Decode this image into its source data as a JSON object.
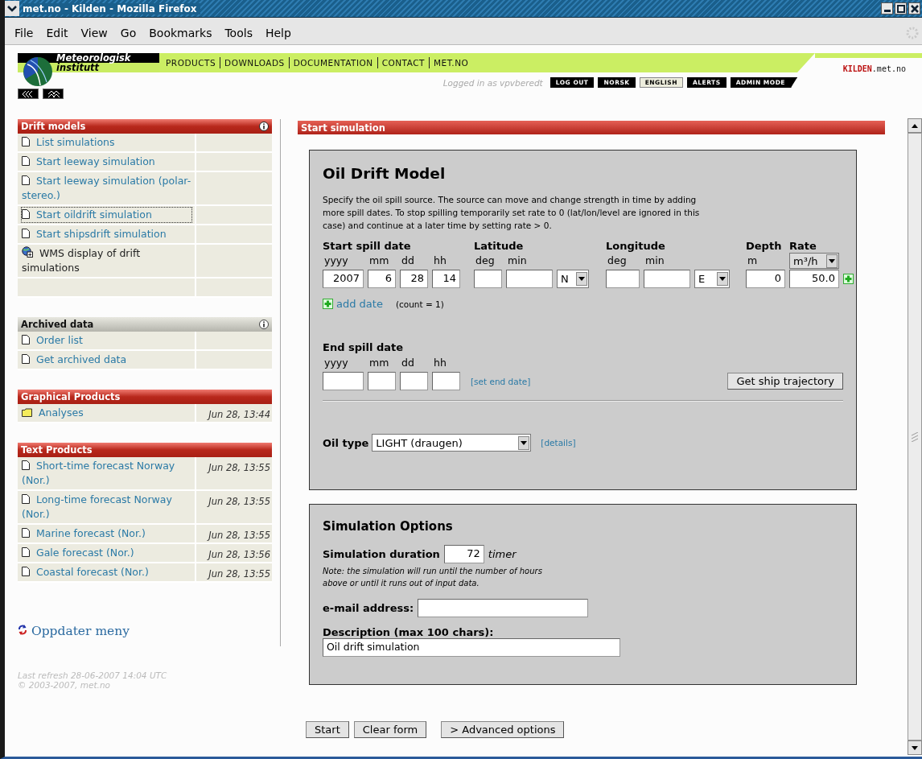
{
  "window": {
    "title": "met.no - Kilden - Mozilla Firefox"
  },
  "menu": [
    "File",
    "Edit",
    "View",
    "Go",
    "Bookmarks",
    "Tools",
    "Help"
  ],
  "header": {
    "logo_line1": "Meteorologisk",
    "logo_line2": "institutt",
    "nav": [
      "PRODUCTS",
      "DOWNLOADS",
      "DOCUMENTATION",
      "CONTACT",
      "MET.NO"
    ],
    "logged_in": "Logged in as vpvberedt",
    "buttons": [
      {
        "label": "LOG OUT",
        "selected": false
      },
      {
        "label": "NORSK",
        "selected": false
      },
      {
        "label": "ENGLISH",
        "selected": true
      },
      {
        "label": "ALERTS",
        "selected": false
      },
      {
        "label": "ADMIN MODE",
        "selected": false
      }
    ],
    "site": "KILDEN",
    "site_suffix": ".met.no"
  },
  "sidebar": [
    {
      "title": "Drift models",
      "kind": "primary",
      "info": true,
      "trailing_blank": true,
      "items": [
        {
          "label": "List simulations",
          "kind": "page",
          "link": true,
          "selected": false
        },
        {
          "label": "Start leeway simulation",
          "kind": "page",
          "link": true,
          "selected": false
        },
        {
          "label": "Start leeway simulation (polar-stereo.)",
          "kind": "page",
          "link": true,
          "selected": false
        },
        {
          "label": "Start oildrift simulation",
          "kind": "page",
          "link": true,
          "selected": true
        },
        {
          "label": "Start shipsdrift simulation",
          "kind": "page",
          "link": true,
          "selected": false
        },
        {
          "label": "WMS display of drift simulations",
          "kind": "globe",
          "link": false,
          "selected": false
        }
      ]
    },
    {
      "title": "Archived data",
      "kind": "secondary",
      "info": true,
      "trailing_blank": false,
      "items": [
        {
          "label": "Order list",
          "kind": "page",
          "link": true,
          "selected": false
        },
        {
          "label": "Get archived data",
          "kind": "page",
          "link": true,
          "selected": false
        }
      ]
    },
    {
      "title": "Graphical Products",
      "kind": "primary",
      "info": false,
      "trailing_blank": false,
      "items": [
        {
          "label": "Analyses",
          "kind": "folder",
          "link": true,
          "selected": false,
          "time": "Jun 28, 13:44"
        }
      ]
    },
    {
      "title": "Text Products",
      "kind": "primary",
      "info": false,
      "trailing_blank": false,
      "items": [
        {
          "label": "Short-time forecast Norway (Nor.)",
          "kind": "page",
          "link": true,
          "selected": false,
          "time": "Jun 28, 13:55"
        },
        {
          "label": "Long-time forecast Norway (Nor.)",
          "kind": "page",
          "link": true,
          "selected": false,
          "time": "Jun 28, 13:55"
        },
        {
          "label": "Marine forecast (Nor.)",
          "kind": "page",
          "link": true,
          "selected": false,
          "time": "Jun 28, 13:55"
        },
        {
          "label": "Gale forecast (Nor.)",
          "kind": "page",
          "link": true,
          "selected": false,
          "time": "Jun 28, 13:56"
        },
        {
          "label": "Coastal forecast (Nor.)",
          "kind": "page",
          "link": true,
          "selected": false,
          "time": "Jun 28, 13:55"
        }
      ]
    }
  ],
  "refresh_link": "Oppdater meny",
  "footer": [
    "Last refresh 28-06-2007 14:04 UTC",
    "© 2003-2007, met.no"
  ],
  "section_title": "Start simulation",
  "form": {
    "title": "Oil Drift Model",
    "description": "Specify the oil spill source. The source can move and change strength in time by adding more spill dates. To stop spilling temporarily set rate to 0 (lat/lon/level are ignored in this case) and continue at a later time by setting rate > 0.",
    "start_date": {
      "label": "Start spill date",
      "fields": [
        {
          "unit": "yyyy",
          "value": "2007"
        },
        {
          "unit": "mm",
          "value": "6"
        },
        {
          "unit": "dd",
          "value": "28"
        },
        {
          "unit": "hh",
          "value": "14"
        }
      ]
    },
    "latitude": {
      "label": "Latitude",
      "fields": [
        {
          "unit": "deg"
        },
        {
          "unit": "min"
        }
      ],
      "hemisphere": "N"
    },
    "longitude": {
      "label": "Longitude",
      "fields": [
        {
          "unit": "deg"
        },
        {
          "unit": "min"
        }
      ],
      "hemisphere": "E"
    },
    "depth": {
      "label": "Depth",
      "unit": "m",
      "value": "0"
    },
    "rate": {
      "label": "Rate",
      "unit": "m³/h",
      "value": "50.0"
    },
    "add_date": "add date",
    "count": "(count = 1)",
    "end_date": {
      "label": "End spill date",
      "fields": [
        {
          "unit": "yyyy"
        },
        {
          "unit": "mm"
        },
        {
          "unit": "dd"
        },
        {
          "unit": "hh"
        }
      ]
    },
    "set_end": "[set end date]",
    "ship_button": "Get ship trajectory",
    "oil_type_label": "Oil type",
    "oil_type": "LIGHT (draugen)",
    "details": "[details]"
  },
  "options": {
    "title": "Simulation Options",
    "duration_label": "Simulation duration",
    "duration": "72",
    "duration_unit": "timer",
    "note": "Note: the simulation will run until the number of hours above or until it runs out of input data.",
    "email_label": "e-mail address:",
    "description_label": "Description (max 100 chars):",
    "description_value": "Oil drift simulation"
  },
  "actions": [
    "Start",
    "Clear form",
    "> Advanced options"
  ]
}
